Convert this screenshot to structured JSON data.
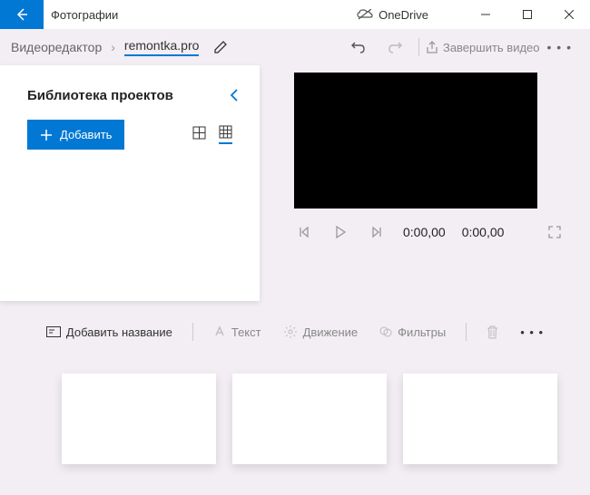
{
  "titlebar": {
    "app_title": "Фотографии",
    "onedrive_label": "OneDrive"
  },
  "breadcrumb": {
    "root": "Видеоредактор",
    "current": "remontka.pro"
  },
  "toolbar": {
    "finish_label": "Завершить видео"
  },
  "library": {
    "title": "Библиотека проектов",
    "add_label": "Добавить"
  },
  "player": {
    "current_time": "0:00,00",
    "total_time": "0:00,00"
  },
  "edit_toolbar": {
    "add_title": "Добавить название",
    "text": "Текст",
    "motion": "Движение",
    "filters": "Фильтры"
  }
}
